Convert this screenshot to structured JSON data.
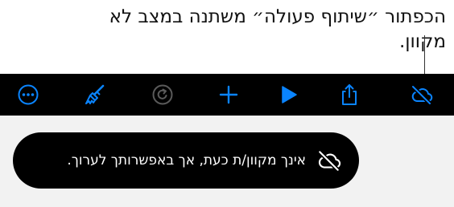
{
  "callout": {
    "text": "הכפתור ״שיתוף פעולה״ משתנה במצב לא מקוון."
  },
  "toolbar": {
    "buttons": [
      {
        "name": "more-button",
        "icon": "ellipsis-circle-icon"
      },
      {
        "name": "format-button",
        "icon": "paintbrush-icon"
      },
      {
        "name": "redo-button",
        "icon": "redo-circle-icon"
      },
      {
        "name": "insert-button",
        "icon": "plus-icon"
      },
      {
        "name": "play-button",
        "icon": "play-icon"
      },
      {
        "name": "share-button",
        "icon": "share-icon"
      },
      {
        "name": "collaborate-offline-button",
        "icon": "cloud-slash-icon"
      }
    ],
    "accent_color": "#0a84ff",
    "disabled_color": "#5a5a5a"
  },
  "toast": {
    "message": "אינך מקוון/ת כעת, אך באפשרותך לערוך.",
    "icon": "cloud-slash-icon"
  }
}
